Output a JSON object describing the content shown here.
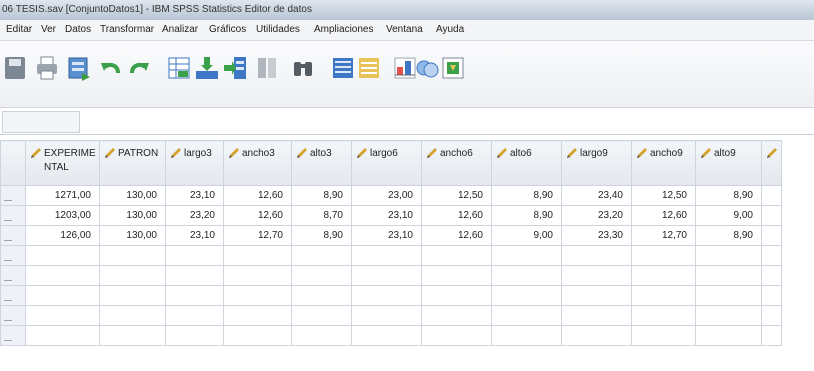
{
  "window": {
    "title": "06 TESIS.sav [ConjuntoDatos1] - IBM SPSS Statistics Editor de datos"
  },
  "menu": [
    "Editar",
    "Ver",
    "Datos",
    "Transformar",
    "Analizar",
    "Gráficos",
    "Utilidades",
    "Ampliaciones",
    "Ventana",
    "Ayuda"
  ],
  "toolbar": {
    "icons": [
      "save-icon",
      "print-icon",
      "dialog-recall-icon",
      "undo-icon",
      "redo-icon",
      "goto-case-icon",
      "goto-variable-icon",
      "variables-icon",
      "split-file-icon",
      "find-icon",
      "insert-cases-icon",
      "insert-variable-icon",
      "weight-cases-icon",
      "select-cases-icon",
      "value-labels-icon"
    ]
  },
  "grid": {
    "columns": [
      "EXPERIMENTAL",
      "PATRON",
      "largo3",
      "ancho3",
      "alto3",
      "largo6",
      "ancho6",
      "alto6",
      "largo9",
      "ancho9",
      "alto9"
    ],
    "rows": [
      [
        "1271,00",
        "130,00",
        "23,10",
        "12,60",
        "8,90",
        "23,00",
        "12,50",
        "8,90",
        "23,40",
        "12,50",
        "8,90"
      ],
      [
        "1203,00",
        "130,00",
        "23,20",
        "12,60",
        "8,70",
        "23,10",
        "12,60",
        "8,90",
        "23,20",
        "12,60",
        "9,00"
      ],
      [
        "126,00",
        "130,00",
        "23,10",
        "12,70",
        "8,90",
        "23,10",
        "12,60",
        "9,00",
        "23,30",
        "12,70",
        "8,90"
      ]
    ],
    "empty_rows": 5
  },
  "colors": {
    "header_bg": "#e3e8ee",
    "grid_line": "#cfd5dc",
    "pencil": "#d4a12a"
  }
}
